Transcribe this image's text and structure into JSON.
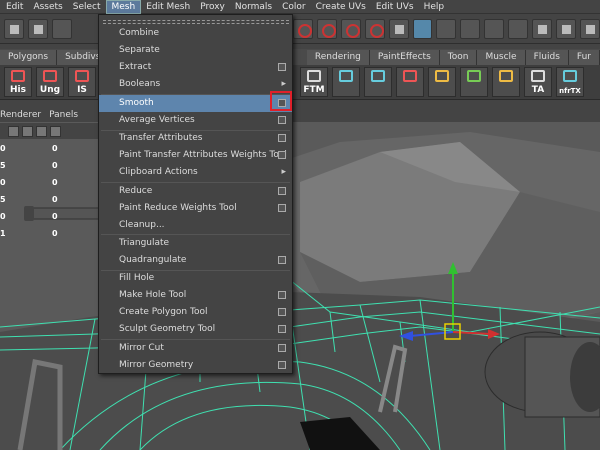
{
  "menubar": {
    "items": [
      "Edit",
      "Assets",
      "Select",
      "Mesh",
      "Edit Mesh",
      "Proxy",
      "Normals",
      "Color",
      "Create UVs",
      "Edit UVs",
      "Help"
    ],
    "active": "Mesh"
  },
  "shelf_tabs": [
    "Polygons",
    "Subdivs",
    "Rendering",
    "PaintEffects",
    "Toon",
    "Muscle",
    "Fluids",
    "Fur"
  ],
  "shelf": {
    "buttons": [
      {
        "label": "His",
        "icon": "history-icon"
      },
      {
        "label": "Ung",
        "icon": "ungroup-icon"
      },
      {
        "label": "IS",
        "icon": "is-icon"
      },
      {
        "label": "FTM",
        "icon": "ftm-icon"
      },
      {
        "label": "TA",
        "icon": "ta-icon"
      },
      {
        "label": "nfrTX",
        "icon": "nfrtx-icon"
      }
    ]
  },
  "channel_box": {
    "tabs": [
      "Renderer",
      "Panels"
    ],
    "rows": [
      {
        "left": "0",
        "right": "0"
      },
      {
        "left": "5",
        "right": "0"
      },
      {
        "left": "0",
        "right": "0"
      },
      {
        "left": "5",
        "right": "0"
      },
      {
        "left": "0",
        "right": "0"
      },
      {
        "left": "1",
        "right": "0"
      }
    ]
  },
  "mesh_menu": {
    "items": [
      {
        "label": "Combine",
        "option": false,
        "submenu": false
      },
      {
        "label": "Separate",
        "option": false,
        "submenu": false
      },
      {
        "label": "Extract",
        "option": true,
        "submenu": false
      },
      {
        "label": "Booleans",
        "option": false,
        "submenu": true
      },
      {
        "label": "Smooth",
        "option": true,
        "submenu": false,
        "highlighted": true
      },
      {
        "label": "Average Vertices",
        "option": true,
        "submenu": false
      },
      {
        "label": "Transfer Attributes",
        "option": true,
        "submenu": false
      },
      {
        "label": "Paint Transfer Attributes Weights Tool",
        "option": true,
        "submenu": false
      },
      {
        "label": "Clipboard Actions",
        "option": false,
        "submenu": true
      },
      {
        "label": "Reduce",
        "option": true,
        "submenu": false
      },
      {
        "label": "Paint Reduce Weights Tool",
        "option": true,
        "submenu": false
      },
      {
        "label": "Cleanup...",
        "option": false,
        "submenu": false
      },
      {
        "label": "Triangulate",
        "option": false,
        "submenu": false
      },
      {
        "label": "Quadrangulate",
        "option": true,
        "submenu": false
      },
      {
        "label": "Fill Hole",
        "option": false,
        "submenu": false
      },
      {
        "label": "Make Hole Tool",
        "option": true,
        "submenu": false
      },
      {
        "label": "Create Polygon Tool",
        "option": true,
        "submenu": false
      },
      {
        "label": "Sculpt Geometry Tool",
        "option": true,
        "submenu": false
      },
      {
        "label": "Mirror Cut",
        "option": true,
        "submenu": false
      },
      {
        "label": "Mirror Geometry",
        "option": true,
        "submenu": false
      }
    ],
    "highlight_color": "#5e85ad",
    "callout_color": "#e0202a"
  },
  "colors": {
    "wireframe": "#3fe0b0",
    "manip_x": "#d03030",
    "manip_y": "#30c030",
    "manip_z": "#3050e0",
    "manip_center": "#e8d000"
  }
}
